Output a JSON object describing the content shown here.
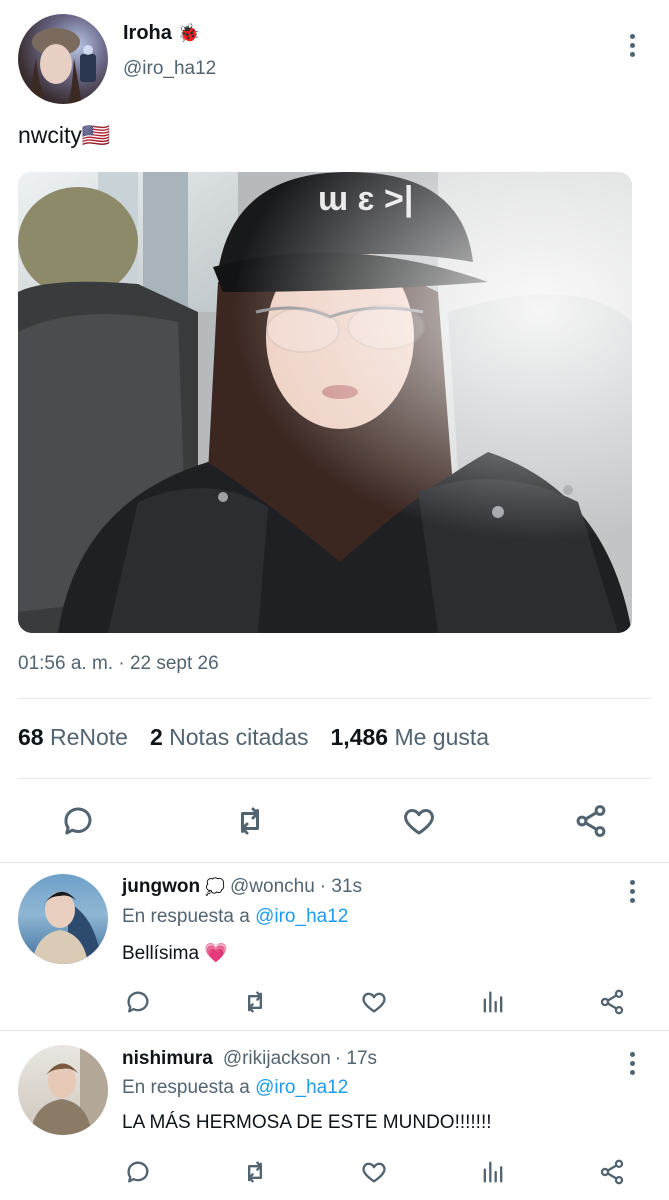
{
  "post": {
    "author_name": "Iroha",
    "author_emoji": "🐞",
    "author_handle": "@iro_ha12",
    "text": "nwcity🇺🇸",
    "timestamp": "01:56 a. m. · 22 sept 26",
    "stats": {
      "renotes_count": "68",
      "renotes_label": "ReNote",
      "quotes_count": "2",
      "quotes_label": "Notas citadas",
      "likes_count": "1,486",
      "likes_label": "Me gusta"
    }
  },
  "replies": [
    {
      "name": "jungwon",
      "emoji": "💭",
      "handle": "@wonchu",
      "time": "· 31s",
      "reply_prefix": "En respuesta a",
      "reply_to": "@iro_ha12",
      "text": "Bellísima 💗"
    },
    {
      "name": "nishimura",
      "handle": "@rikijackson",
      "time": "· 17s",
      "reply_prefix": "En respuesta a",
      "reply_to": "@iro_ha12",
      "text": "LA MÁS HERMOSA DE ESTE MUNDO!!!!!!!"
    }
  ],
  "icons": {
    "reply": "speech-bubble-icon",
    "renote": "retweet-arrows-icon",
    "like": "heart-icon",
    "share": "share-nodes-icon",
    "views": "bar-chart-icon",
    "more": "vertical-dots-icon"
  }
}
